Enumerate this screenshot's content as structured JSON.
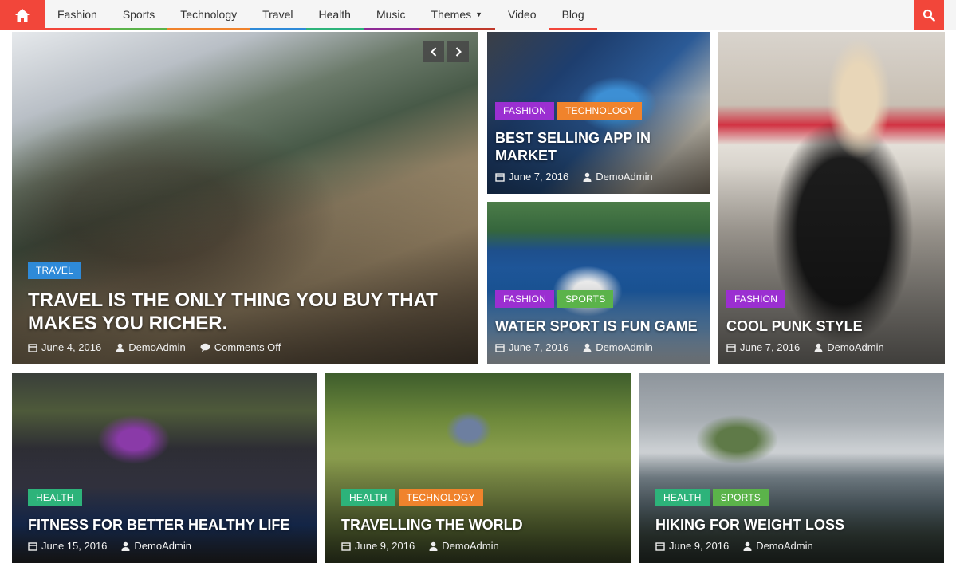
{
  "nav": {
    "home_icon": "home-icon",
    "search_icon": "search-icon",
    "menu": [
      {
        "label": "Fashion",
        "color": "#f2463a"
      },
      {
        "label": "Sports",
        "color": "#5bb34a"
      },
      {
        "label": "Technology",
        "color": "#f0832c"
      },
      {
        "label": "Travel",
        "color": "#2e8ad8"
      },
      {
        "label": "Health",
        "color": "#2db37a"
      },
      {
        "label": "Music",
        "color": "#8e2b95"
      },
      {
        "label": "Themes",
        "color": "#c0392b"
      },
      {
        "label": "Video",
        "color": "#f5f5f5"
      },
      {
        "label": "Blog",
        "color": "#f2463a"
      }
    ]
  },
  "colors": {
    "accent": "#f2463a",
    "cat_travel": "#2e8ad8",
    "cat_fashion": "#9b2fd1",
    "cat_technology": "#f0832c",
    "cat_sports": "#5bb34a",
    "cat_health": "#2db37a"
  },
  "slider": {
    "prev_icon": "chevron-left-icon",
    "next_icon": "chevron-right-icon"
  },
  "posts": {
    "featured": {
      "categories": [
        "Travel"
      ],
      "title": "Travel is the only thing you buy that makes you richer.",
      "date": "June 4, 2016",
      "author": "DemoAdmin",
      "comments": "Comments Off"
    },
    "app": {
      "categories": [
        "Fashion",
        "Technology"
      ],
      "title": "Best Selling App in Market",
      "date": "June 7, 2016",
      "author": "DemoAdmin"
    },
    "water": {
      "categories": [
        "Fashion",
        "Sports"
      ],
      "title": "Water Sport is Fun Game",
      "date": "June 7, 2016",
      "author": "DemoAdmin"
    },
    "punk": {
      "categories": [
        "Fashion"
      ],
      "title": "Cool Punk Style",
      "date": "June 7, 2016",
      "author": "DemoAdmin"
    },
    "fitness": {
      "categories": [
        "Health"
      ],
      "title": "Fitness for Better Healthy Life",
      "date": "June 15, 2016",
      "author": "DemoAdmin"
    },
    "world": {
      "categories": [
        "Health",
        "Technology"
      ],
      "title": "Travelling the World",
      "date": "June 9, 2016",
      "author": "DemoAdmin"
    },
    "hiking": {
      "categories": [
        "Health",
        "Sports"
      ],
      "title": "Hiking for Weight Loss",
      "date": "June 9, 2016",
      "author": "DemoAdmin"
    }
  }
}
